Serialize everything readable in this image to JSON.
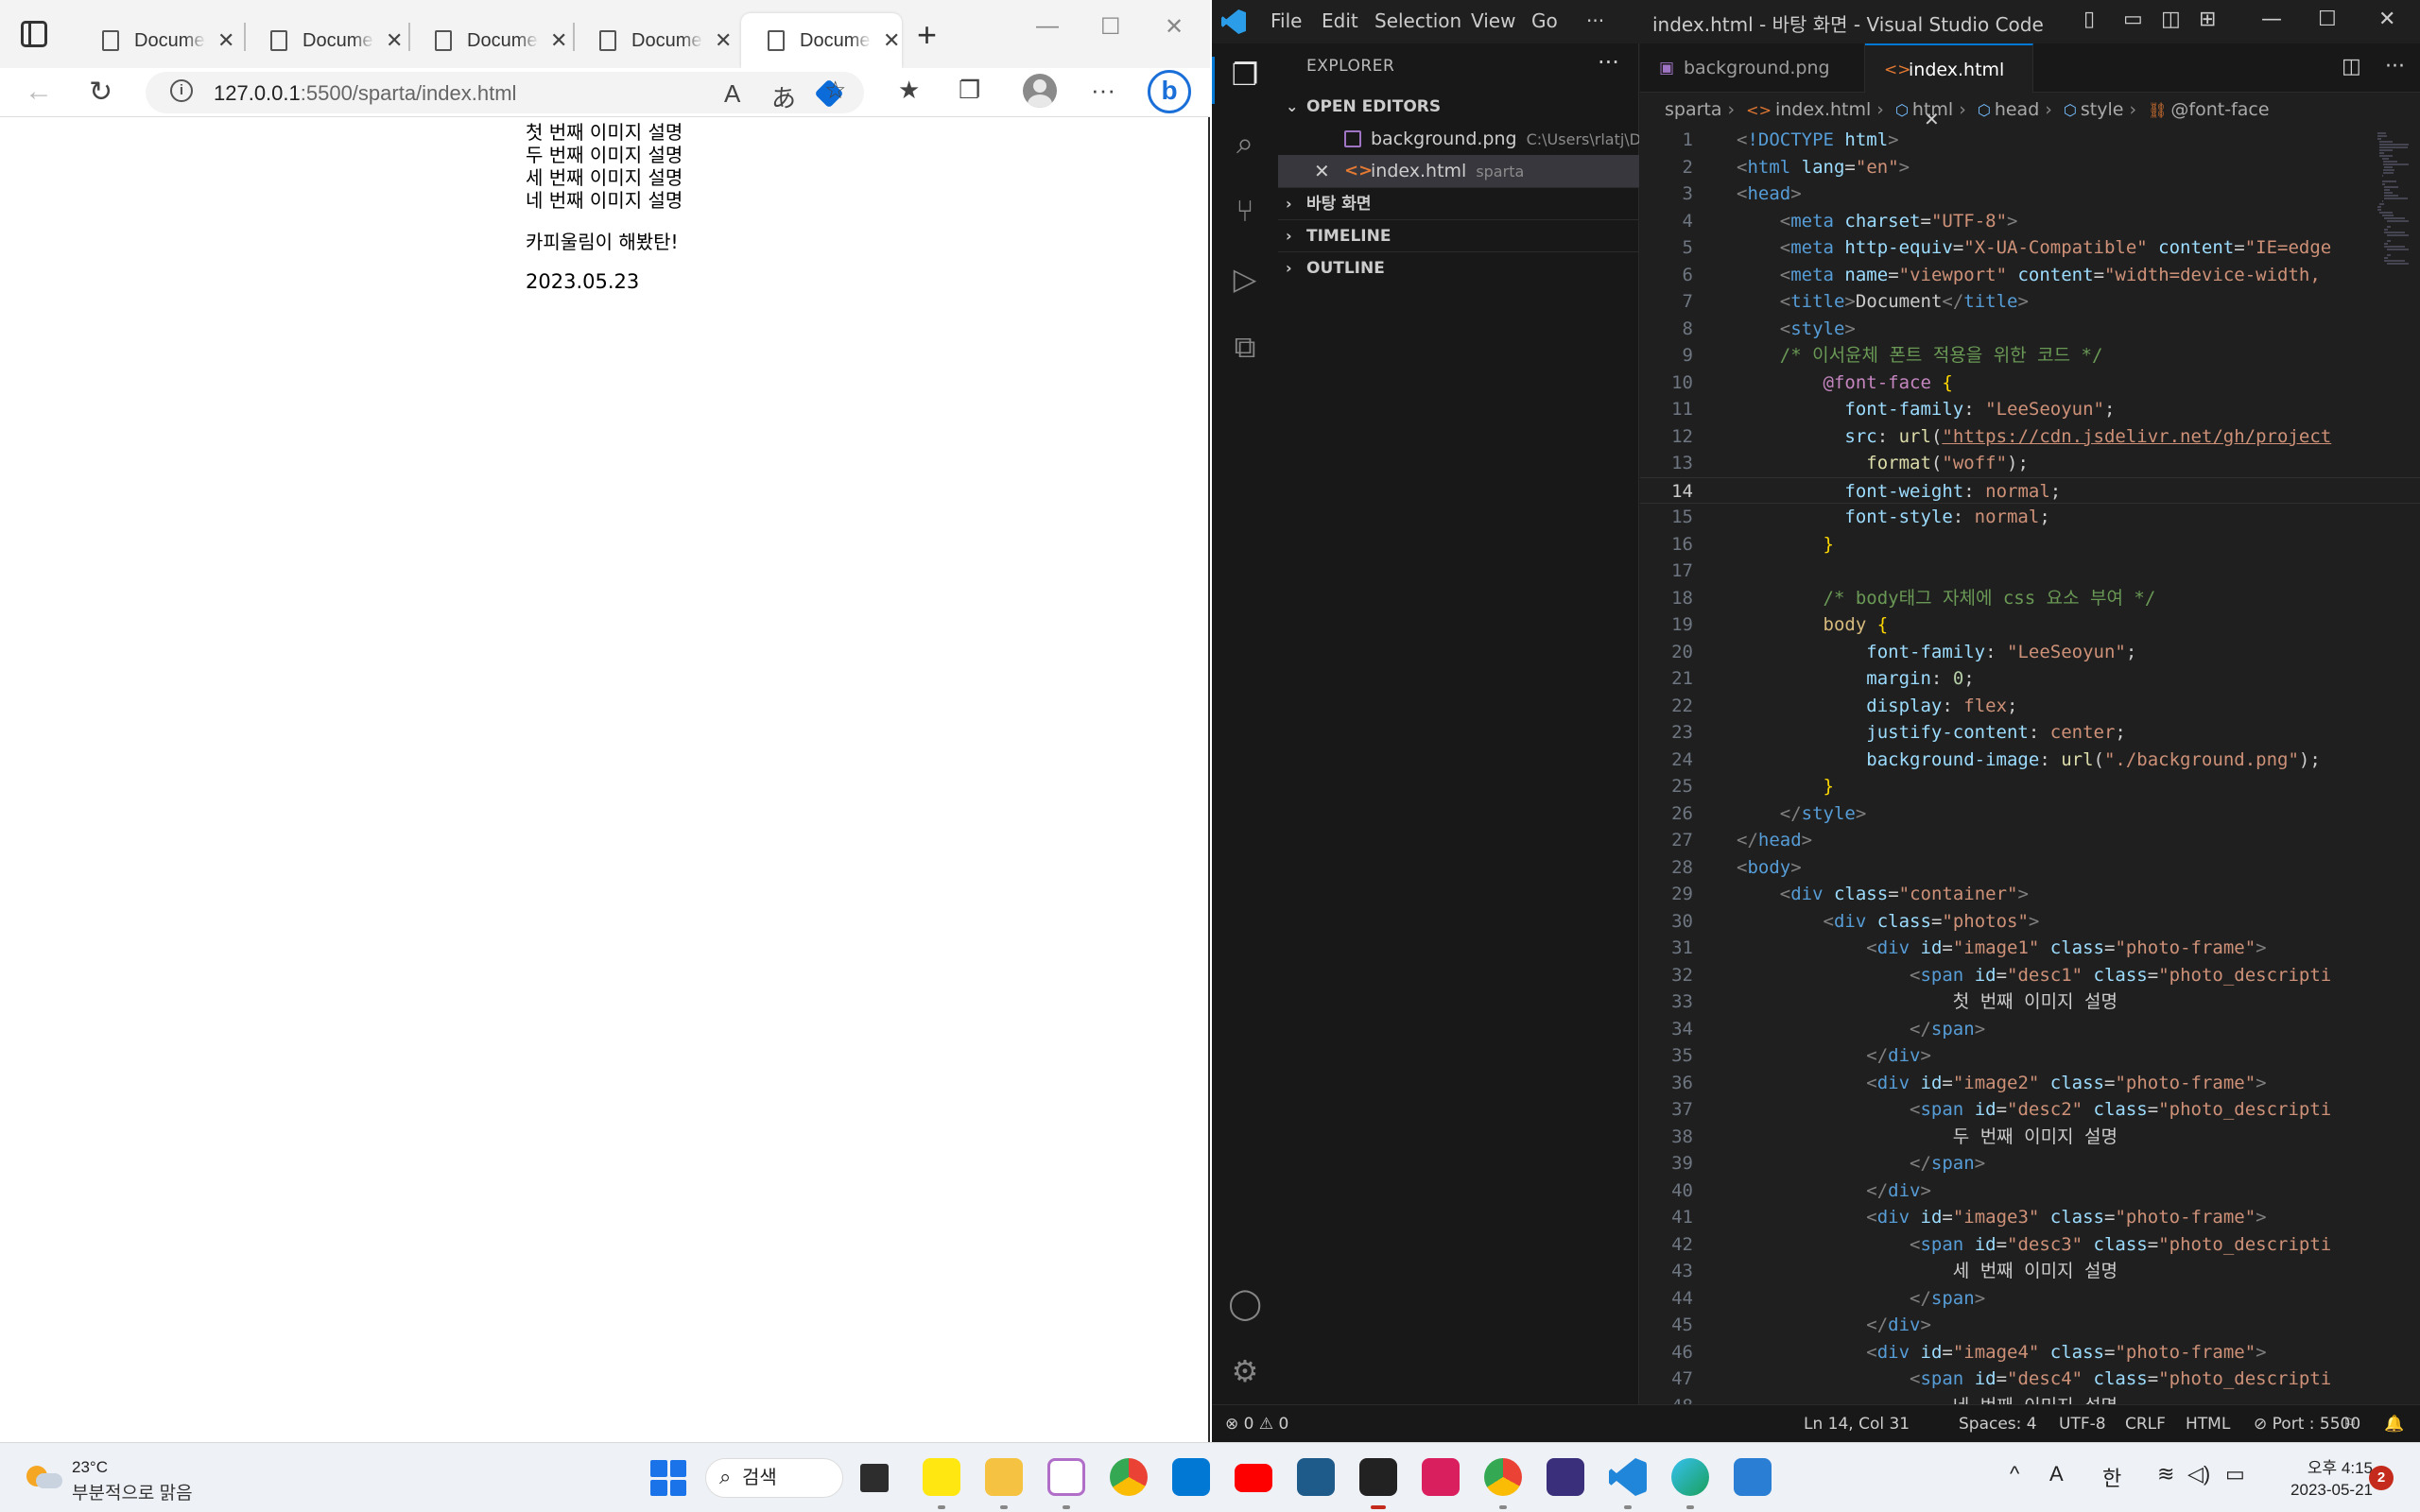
{
  "browser": {
    "tabs": [
      {
        "title": "Document"
      },
      {
        "title": "Document"
      },
      {
        "title": "Document"
      },
      {
        "title": "Document"
      },
      {
        "title": "Document"
      }
    ],
    "url_host": "127.0.0.1",
    "url_rest": ":5500/sparta/index.html",
    "page": {
      "descriptions": [
        "첫 번째 이미지 설명",
        "두 번째 이미지 설명",
        "세 번째 이미지 설명",
        "네 번째 이미지 설명"
      ],
      "credit": "카피울림이 해봤탄!",
      "date": "2023.05.23"
    }
  },
  "vscode": {
    "menu": [
      "File",
      "Edit",
      "Selection",
      "View",
      "Go",
      "···"
    ],
    "window_title": "index.html - 바탕 화면 - Visual Studio Code",
    "explorer_title": "EXPLORER",
    "open_editors_label": "OPEN EDITORS",
    "open_editors": [
      {
        "name": "background.png",
        "path": "C:\\Users\\rlatj\\D..."
      },
      {
        "name": "index.html",
        "path": "sparta"
      }
    ],
    "folder_label": "바탕 화면",
    "timeline_label": "TIMELINE",
    "outline_label": "OUTLINE",
    "editor_tabs": [
      {
        "name": "background.png"
      },
      {
        "name": "index.html"
      }
    ],
    "breadcrumb": [
      "sparta",
      "index.html",
      "html",
      "head",
      "style",
      "@font-face"
    ],
    "current_line": 14,
    "status": {
      "problems": "0",
      "warnings": "0",
      "position": "Ln 14, Col 31",
      "spaces": "Spaces: 4",
      "encoding": "UTF-8",
      "eol": "CRLF",
      "language": "HTML",
      "port": "Port : 5500"
    }
  },
  "taskbar": {
    "weather_temp": "23°C",
    "weather_desc": "부분적으로 맑음",
    "search_label": "검색",
    "ime_lang": "A",
    "ime_mode": "한",
    "clock_time": "오후 4:15",
    "clock_date": "2023-05-21",
    "notifications": "2"
  },
  "colors": {
    "vscode_bg": "#1e1e1e",
    "accent": "#0078d4",
    "edge_blue": "#1b6fd8"
  }
}
